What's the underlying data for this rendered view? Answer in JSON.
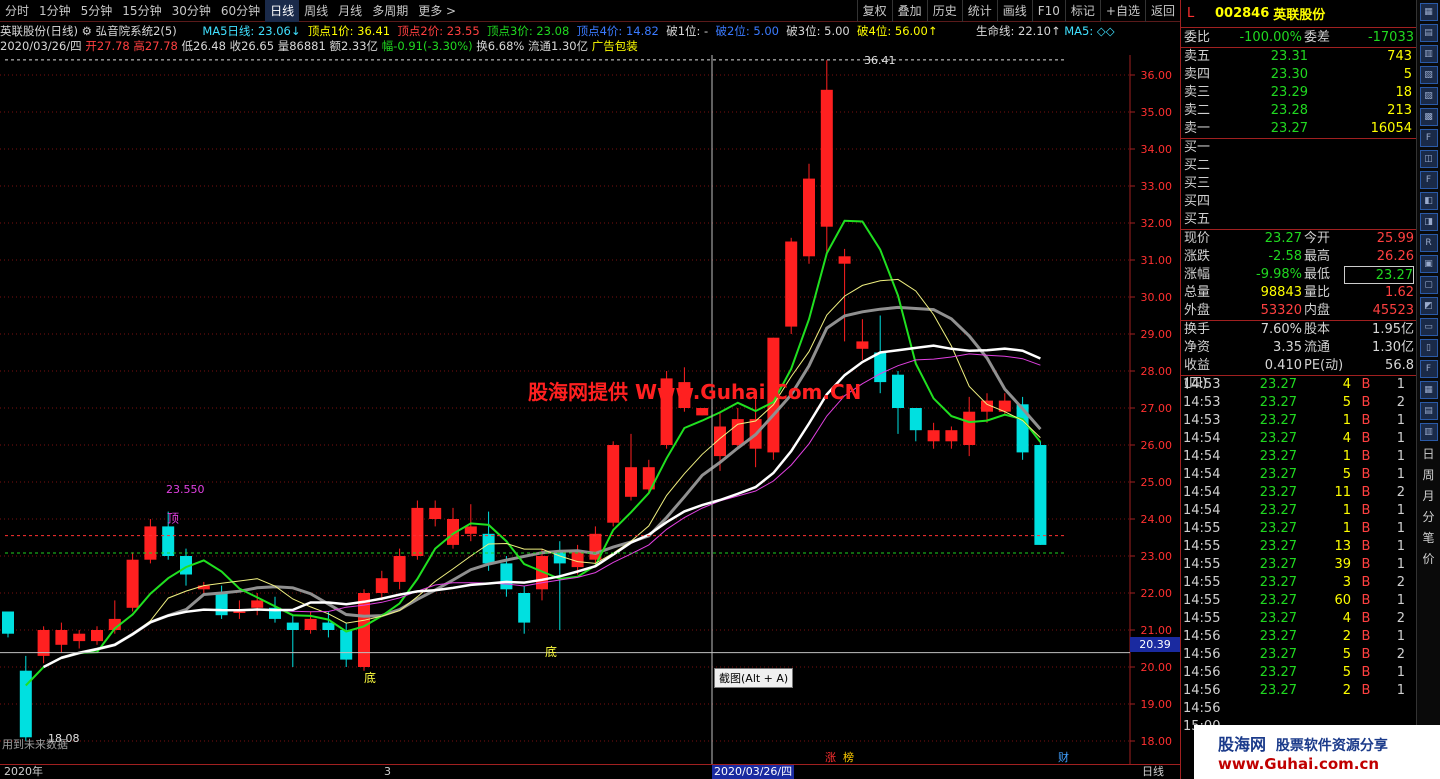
{
  "toolbar": {
    "periods": [
      "分时",
      "1分钟",
      "5分钟",
      "15分钟",
      "30分钟",
      "60分钟",
      "日线",
      "周线",
      "月线",
      "多周期",
      "更多 >"
    ],
    "active": "日线",
    "right_items": [
      "复权",
      "叠加",
      "历史",
      "统计",
      "画线",
      "F10",
      "标记",
      "+自选",
      "返回"
    ]
  },
  "info": {
    "stock_name": "英联股份(日线)",
    "indicator": "弘音院系统2(5)",
    "ma5": "MA5日线: 23.06↓",
    "top1": "顶点1价: 36.41",
    "top2": "顶点2价: 23.55",
    "top3": "顶点3价: 23.08",
    "top4": "顶点4价: 14.82",
    "break1": "破1位: -",
    "break2": "破2位: 5.00",
    "break3": "破3位: 5.00",
    "break4": "破4位: 56.00↑",
    "lifeline": "生命线: 22.10↑",
    "ma5b": "MA5: ◇◇",
    "date": "2020/03/26/四",
    "open": "开27.78",
    "high": "高27.78",
    "low": "低26.48",
    "close": "收26.65",
    "volume": "量86881",
    "amount": "额2.33亿",
    "change": "幅-0.91(-3.30%)",
    "turnover": "换6.68%",
    "float": "流通1.30亿",
    "sector": "广告包装"
  },
  "chart_labels": {
    "peak": "36.41",
    "low": "18.08",
    "mark": "23.550",
    "ding": "顶",
    "di1": "底",
    "di2": "底",
    "nodata": "用到未来数据",
    "price_tag": "20.39",
    "zhang": "涨",
    "bang": "榜",
    "cai": "财"
  },
  "chart_data": {
    "type": "candlestick",
    "yaxis": [
      36.0,
      35.0,
      34.0,
      33.0,
      32.0,
      31.0,
      30.0,
      29.0,
      28.0,
      27.0,
      26.0,
      25.0,
      24.0,
      23.0,
      22.0,
      21.0,
      20.0,
      19.0,
      18.0
    ],
    "ylim": [
      17.6,
      36.7
    ],
    "xlabels": [
      "2020年",
      "3",
      "2020/03/26/四",
      "日线"
    ],
    "candles": [
      [
        21.5,
        20.9,
        21.5,
        20.8
      ],
      [
        19.9,
        18.1,
        20.3,
        18.0
      ],
      [
        20.3,
        21.0,
        21.1,
        20.1
      ],
      [
        20.6,
        21.0,
        21.2,
        20.4
      ],
      [
        20.7,
        20.9,
        21.0,
        20.5
      ],
      [
        20.7,
        21.0,
        21.1,
        20.6
      ],
      [
        21.0,
        21.3,
        21.8,
        20.9
      ],
      [
        21.6,
        22.9,
        23.1,
        21.5
      ],
      [
        22.9,
        23.8,
        24.0,
        22.8
      ],
      [
        23.8,
        23.0,
        24.2,
        22.9
      ],
      [
        23.0,
        22.5,
        23.2,
        22.2
      ],
      [
        22.1,
        22.2,
        22.3,
        22.0
      ],
      [
        22.0,
        21.4,
        22.2,
        21.3
      ],
      [
        21.5,
        21.5,
        21.8,
        21.3
      ],
      [
        21.6,
        21.8,
        22.0,
        21.4
      ],
      [
        21.6,
        21.3,
        21.9,
        21.2
      ],
      [
        21.2,
        21.0,
        21.4,
        20.0
      ],
      [
        21.0,
        21.3,
        21.5,
        20.9
      ],
      [
        21.2,
        21.0,
        21.5,
        20.8
      ],
      [
        21.0,
        20.2,
        21.2,
        20.0
      ],
      [
        20.0,
        22.0,
        22.1,
        19.9
      ],
      [
        22.0,
        22.4,
        22.6,
        21.8
      ],
      [
        22.3,
        23.0,
        23.2,
        22.1
      ],
      [
        23.0,
        24.3,
        24.5,
        22.9
      ],
      [
        24.0,
        24.3,
        24.5,
        23.8
      ],
      [
        23.3,
        24.0,
        24.3,
        23.2
      ],
      [
        23.6,
        23.8,
        24.4,
        23.4
      ],
      [
        23.6,
        22.8,
        24.2,
        22.6
      ],
      [
        22.8,
        22.1,
        23.0,
        21.9
      ],
      [
        22.0,
        21.2,
        22.2,
        20.9
      ],
      [
        22.1,
        23.0,
        23.2,
        21.8
      ],
      [
        23.1,
        22.8,
        23.4,
        21.0
      ],
      [
        22.7,
        23.1,
        23.3,
        22.5
      ],
      [
        22.9,
        23.6,
        23.8,
        22.8
      ],
      [
        23.9,
        26.0,
        26.1,
        23.8
      ],
      [
        24.6,
        25.4,
        26.3,
        24.5
      ],
      [
        24.8,
        25.4,
        25.6,
        24.7
      ],
      [
        26.0,
        27.8,
        28.0,
        25.9
      ],
      [
        27.0,
        27.7,
        28.1,
        26.9
      ],
      [
        26.8,
        27.0,
        27.0,
        26.8
      ],
      [
        25.7,
        26.5,
        26.9,
        25.3
      ],
      [
        26.0,
        26.7,
        27.0,
        25.9
      ],
      [
        25.9,
        26.7,
        27.3,
        25.4
      ],
      [
        25.8,
        28.9,
        28.9,
        25.6
      ],
      [
        29.2,
        31.5,
        31.6,
        29.0
      ],
      [
        31.1,
        33.2,
        33.6,
        30.9
      ],
      [
        31.9,
        35.6,
        36.4,
        31.2
      ],
      [
        30.9,
        31.1,
        31.3,
        28.8
      ],
      [
        28.6,
        28.8,
        29.4,
        28.3
      ],
      [
        28.5,
        27.7,
        29.5,
        27.4
      ],
      [
        27.9,
        27.0,
        28.0,
        26.3
      ],
      [
        27.0,
        26.4,
        27.0,
        26.1
      ],
      [
        26.1,
        26.4,
        26.6,
        25.9
      ],
      [
        26.1,
        26.4,
        26.5,
        25.9
      ],
      [
        26.0,
        26.9,
        27.3,
        25.7
      ],
      [
        26.9,
        27.2,
        27.4,
        26.6
      ],
      [
        26.9,
        27.2,
        27.4,
        26.8
      ],
      [
        27.1,
        25.8,
        27.3,
        25.6
      ],
      [
        26.0,
        23.3,
        26.1,
        23.3
      ]
    ]
  },
  "panel": {
    "header_code": "002846",
    "header_name": "英联股份",
    "header_l": "L",
    "weibi_label": "委比",
    "weibi": "-100.00%",
    "weicha_label": "委差",
    "weicha": "-17033",
    "sells": [
      {
        "label": "卖五",
        "price": "23.31",
        "vol": "743"
      },
      {
        "label": "卖四",
        "price": "23.30",
        "vol": "5"
      },
      {
        "label": "卖三",
        "price": "23.29",
        "vol": "18"
      },
      {
        "label": "卖二",
        "price": "23.28",
        "vol": "213"
      },
      {
        "label": "卖一",
        "price": "23.27",
        "vol": "16054"
      }
    ],
    "buys": [
      "买一",
      "买二",
      "买三",
      "买四",
      "买五"
    ],
    "stats": [
      {
        "l1": "现价",
        "v1": "23.27",
        "l2": "今开",
        "v2": "25.99"
      },
      {
        "l1": "涨跌",
        "v1": "-2.58",
        "l2": "最高",
        "v2": "26.26"
      },
      {
        "l1": "涨幅",
        "v1": "-9.98%",
        "l2": "最低",
        "v2": "23.27"
      },
      {
        "l1": "总量",
        "v1": "98843",
        "l2": "量比",
        "v2": "1.62"
      },
      {
        "l1": "外盘",
        "v1": "53320",
        "l2": "内盘",
        "v2": "45523"
      }
    ],
    "stats2": [
      {
        "l1": "换手",
        "v1": "7.60%",
        "l2": "股本",
        "v2": "1.95亿"
      },
      {
        "l1": "净资",
        "v1": "3.35",
        "l2": "流通",
        "v2": "1.30亿"
      },
      {
        "l1": "收益(四)",
        "v1": "0.410",
        "l2": "PE(动)",
        "v2": "56.8"
      }
    ],
    "ticks": [
      {
        "t": "14:53",
        "p": "23.27",
        "v": "4",
        "bs": "B",
        "n": "1"
      },
      {
        "t": "14:53",
        "p": "23.27",
        "v": "5",
        "bs": "B",
        "n": "2"
      },
      {
        "t": "14:53",
        "p": "23.27",
        "v": "1",
        "bs": "B",
        "n": "1"
      },
      {
        "t": "14:54",
        "p": "23.27",
        "v": "4",
        "bs": "B",
        "n": "1"
      },
      {
        "t": "14:54",
        "p": "23.27",
        "v": "1",
        "bs": "B",
        "n": "1"
      },
      {
        "t": "14:54",
        "p": "23.27",
        "v": "5",
        "bs": "B",
        "n": "1"
      },
      {
        "t": "14:54",
        "p": "23.27",
        "v": "11",
        "bs": "B",
        "n": "2"
      },
      {
        "t": "14:54",
        "p": "23.27",
        "v": "1",
        "bs": "B",
        "n": "1"
      },
      {
        "t": "14:55",
        "p": "23.27",
        "v": "1",
        "bs": "B",
        "n": "1"
      },
      {
        "t": "14:55",
        "p": "23.27",
        "v": "13",
        "bs": "B",
        "n": "1"
      },
      {
        "t": "14:55",
        "p": "23.27",
        "v": "39",
        "bs": "B",
        "n": "1"
      },
      {
        "t": "14:55",
        "p": "23.27",
        "v": "3",
        "bs": "B",
        "n": "2"
      },
      {
        "t": "14:55",
        "p": "23.27",
        "v": "60",
        "bs": "B",
        "n": "1"
      },
      {
        "t": "14:55",
        "p": "23.27",
        "v": "4",
        "bs": "B",
        "n": "2"
      },
      {
        "t": "14:56",
        "p": "23.27",
        "v": "2",
        "bs": "B",
        "n": "1"
      },
      {
        "t": "14:56",
        "p": "23.27",
        "v": "5",
        "bs": "B",
        "n": "2"
      },
      {
        "t": "14:56",
        "p": "23.27",
        "v": "5",
        "bs": "B",
        "n": "1"
      },
      {
        "t": "14:56",
        "p": "23.27",
        "v": "2",
        "bs": "B",
        "n": "1"
      },
      {
        "t": "14:56",
        "p": "",
        "v": "",
        "bs": "",
        "n": ""
      },
      {
        "t": "15:00",
        "p": "",
        "v": "",
        "bs": "",
        "n": ""
      }
    ]
  },
  "sidebar": {
    "labels": [
      "日",
      "周",
      "月",
      "分",
      "笔",
      "价"
    ]
  },
  "watermark": "股海网提供 Www.Guhai.Com.CN",
  "tooltip": "截图(Alt + A)",
  "footer": {
    "brand": "股海网",
    "slogan": "股票软件资源分享",
    "url": "www.Guhai.com.cn"
  },
  "colors": {
    "up": "#ff2020",
    "down": "#00e0e0",
    "ma_white": "#ffffff",
    "ma_gray": "#909090",
    "ma_green": "#20e020",
    "ma_yellow": "#ffff00",
    "ma_magenta": "#e040e0",
    "grid": "#7a1010"
  }
}
